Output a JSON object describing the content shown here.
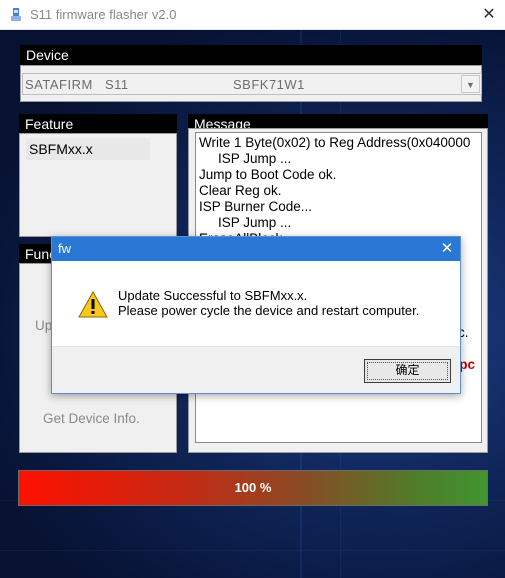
{
  "window": {
    "title": "S11 firmware flasher v2.0"
  },
  "device": {
    "header": "Device",
    "fields": [
      "SATAFIRM",
      "S11",
      "SBFK71W1"
    ]
  },
  "feature": {
    "header": "Feature",
    "items": [
      "SBFMxx.x"
    ]
  },
  "function": {
    "header_partial": "Func",
    "update_partial": "Up",
    "get_device_info": "Get Device Info."
  },
  "message": {
    "header": "Message",
    "lines": [
      "Write 1 Byte(0x02) to Reg Address(0x040000",
      "ISP Jump ...",
      "Jump to Boot Code ok.",
      "Clear Reg ok.",
      "ISP Burner Code...",
      "ISP Jump ...",
      "EraseAllBlock"
    ],
    "partial_right_1": "c.",
    "partial_right_2": "e pc"
  },
  "progress": {
    "label": "100 %",
    "value_percent": 100
  },
  "dialog": {
    "title": "fw",
    "line1": "Update Successful to SBFMxx.x.",
    "line2": "Please power cycle the device and restart computer.",
    "ok_label": "确定"
  }
}
